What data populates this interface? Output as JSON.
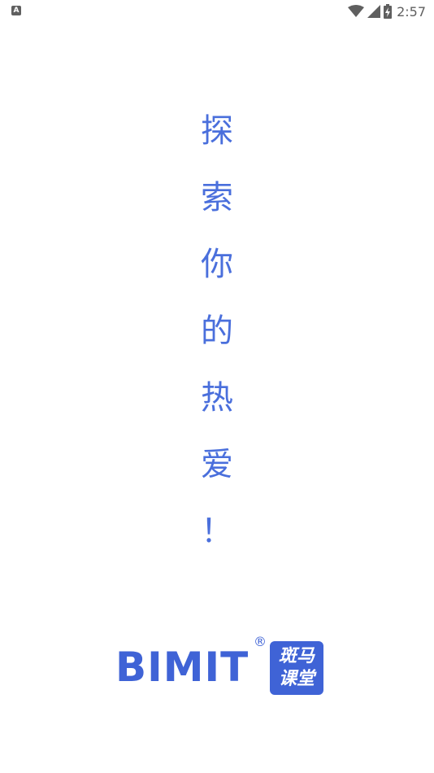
{
  "status_bar": {
    "notification_letter": "A",
    "time": "2:57",
    "icons": [
      "wifi-icon",
      "signal-icon",
      "battery-charging-icon"
    ]
  },
  "slogan": {
    "chars": [
      "探",
      "索",
      "你",
      "的",
      "热",
      "爱",
      "！"
    ]
  },
  "logo": {
    "brand": "BIMIT",
    "registered": "®",
    "badge_line1": "斑马",
    "badge_line2": "课堂"
  },
  "colors": {
    "accent": "#4a6fdc",
    "brand": "#3f63d6",
    "status_icons": "#5f5f5f"
  }
}
